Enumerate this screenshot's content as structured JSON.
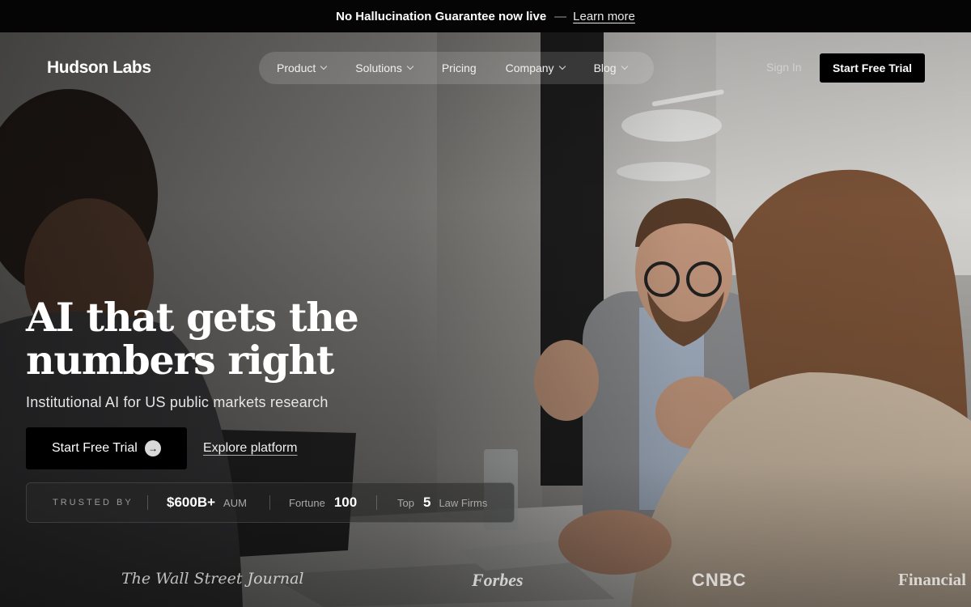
{
  "announcement": {
    "message": "No Hallucination Guarantee now live",
    "separator": "—",
    "link_label": "Learn more"
  },
  "nav": {
    "logo": "Hudson Labs",
    "menu": [
      {
        "label": "Product",
        "dropdown": true
      },
      {
        "label": "Solutions",
        "dropdown": true
      },
      {
        "label": "Pricing",
        "dropdown": false
      },
      {
        "label": "Company",
        "dropdown": true
      },
      {
        "label": "Blog",
        "dropdown": true
      }
    ],
    "sign_in": "Sign In",
    "cta": "Start Free Trial"
  },
  "hero": {
    "headline_line1": "AI that gets the",
    "headline_line2": "numbers right",
    "subheadline": "Institutional AI for US public markets research",
    "primary_cta": "Start Free Trial",
    "primary_cta_icon": "arrow-right-icon",
    "secondary_cta": "Explore platform"
  },
  "trust": {
    "label": "TRUSTED BY",
    "items": [
      {
        "value": "$600B+",
        "suffix": "AUM"
      },
      {
        "prefix": "Fortune",
        "value": "100"
      },
      {
        "prefix": "Top",
        "value": "5",
        "suffix": "Law Firms"
      }
    ]
  },
  "press": [
    "The Wall Street Journal",
    "Forbes",
    "CNBC",
    "Financial"
  ],
  "colors": {
    "background": "#000000",
    "text": "#ffffff",
    "cta_background": "#000000",
    "muted_text": "#a8a8a8"
  }
}
